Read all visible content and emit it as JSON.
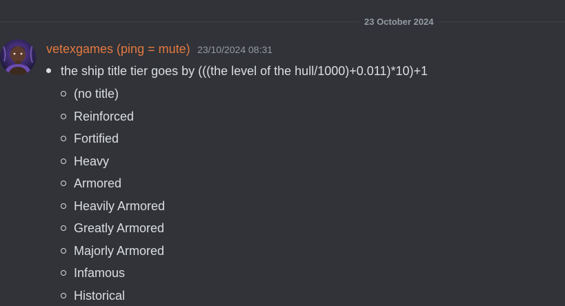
{
  "divider": {
    "date": "23 October 2024"
  },
  "message": {
    "avatar_icon": "avatar-image",
    "username": "vetexgames (ping = mute)",
    "username_color": "#e5793f",
    "timestamp": "23/10/2024 08:31",
    "bullet": "the ship title tier goes by (((the level of the hull/1000)+0.011)*10)+1",
    "titles": [
      "(no title)",
      "Reinforced",
      "Fortified",
      "Heavy",
      "Armored",
      "Heavily Armored",
      "Greatly Armored",
      "Majorly Armored",
      "Infamous",
      "Historical"
    ]
  },
  "colors": {
    "background": "#313338",
    "text": "#dbdee1",
    "muted": "#949ba4"
  }
}
